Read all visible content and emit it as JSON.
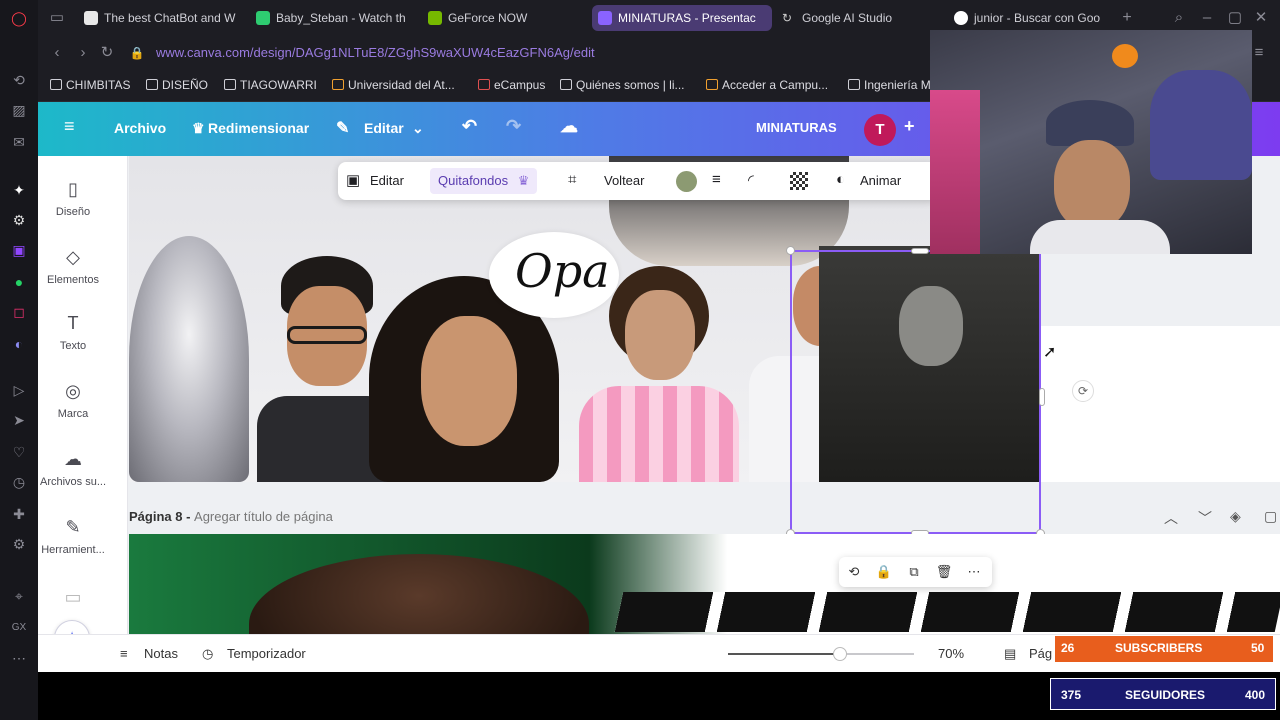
{
  "browser": {
    "tabs": [
      {
        "label": "The best ChatBot and W",
        "color": "#e8e8e8"
      },
      {
        "label": "Baby_Steban - Watch th",
        "color": "#2ecc71"
      },
      {
        "label": "GeForce NOW",
        "color": "#76b900"
      },
      {
        "label": "MINIATURAS - Presentac",
        "color": "#7d3cf0"
      },
      {
        "label": "Google AI Studio",
        "color": "#cccccc"
      },
      {
        "label": "junior - Buscar con Goo",
        "color": "#4285f4"
      }
    ],
    "url": "www.canva.com/design/DAGg1NLTuE8/ZGghS9waXUW4cEazGFN6Ag/edit",
    "bookmarks": [
      "CHIMBITAS",
      "DISEÑO",
      "TIAGOWARRI",
      "Universidad del At...",
      "eCampus",
      "Quiénes somos | li...",
      "Acceder a Campu...",
      "Ingeniería M"
    ]
  },
  "canva": {
    "header": {
      "archivo": "Archivo",
      "redimensionar": "Redimensionar",
      "editar": "Editar",
      "title": "MINIATURAS",
      "avatar": "T"
    },
    "sidebar": [
      {
        "label": "Diseño",
        "icon": "▯"
      },
      {
        "label": "Elementos",
        "icon": "◇"
      },
      {
        "label": "Texto",
        "icon": "T"
      },
      {
        "label": "Marca",
        "icon": "◎"
      },
      {
        "label": "Archivos su...",
        "icon": "☁"
      },
      {
        "label": "Herramient...",
        "icon": "✎"
      }
    ],
    "toolbar": {
      "editar": "Editar",
      "quitafondos": "Quitafondos",
      "voltear": "Voltear",
      "animar": "Animar"
    },
    "speech_bubble": "Opa",
    "page8": {
      "label": "Página 8 - ",
      "placeholder": "Agregar título de página"
    },
    "bottom": {
      "notas": "Notas",
      "temporizador": "Temporizador",
      "zoom": "70%",
      "zoom_fraction": 0.6,
      "pages": "Pág"
    }
  },
  "stream": {
    "subs_count": "26",
    "subs_label": "SUBSCRIBERS",
    "subs_goal": "50",
    "followers_count": "375",
    "followers_label": "SEGUIDORES",
    "followers_goal": "400"
  }
}
